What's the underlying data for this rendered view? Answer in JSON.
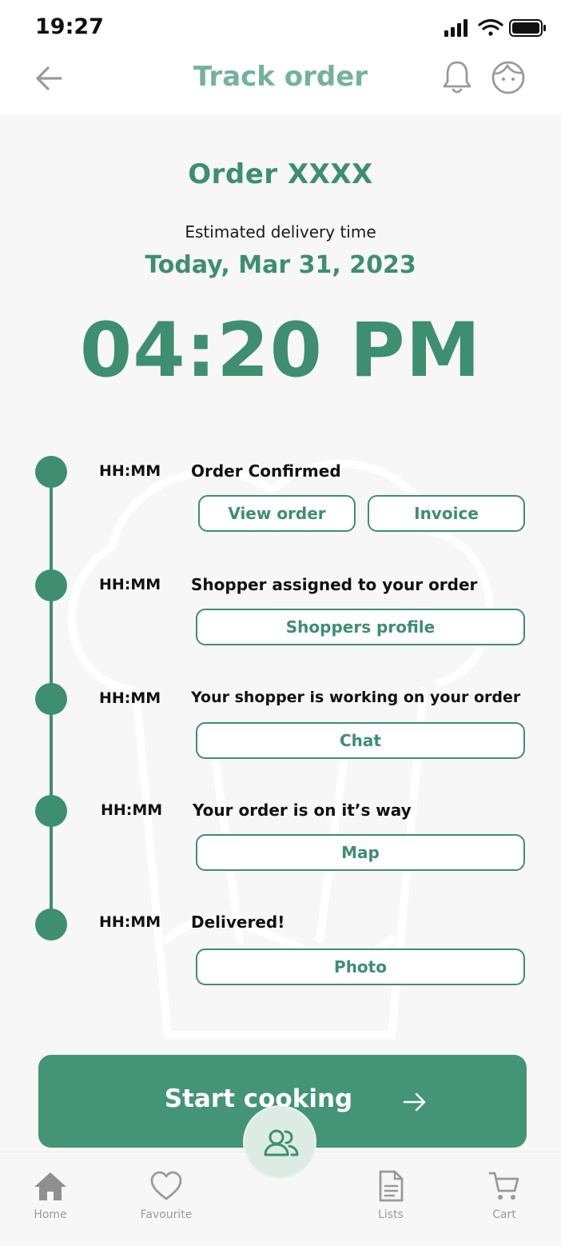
{
  "status_bar": {
    "time": "19:27"
  },
  "header": {
    "title": "Track order"
  },
  "order": {
    "title": "Order XXXX",
    "eta_label": "Estimated delivery time",
    "eta_date": "Today, Mar 31, 2023",
    "eta_time": "04:20 PM"
  },
  "timeline": [
    {
      "time": "HH:MM",
      "label": "Order Confirmed",
      "buttons": [
        "View order",
        "Invoice"
      ]
    },
    {
      "time": "HH:MM",
      "label": "Shopper assigned to your order",
      "buttons": [
        "Shoppers profile"
      ]
    },
    {
      "time": "HH:MM",
      "label": "Your shopper is working on your order",
      "buttons": [
        "Chat"
      ]
    },
    {
      "time": "HH:MM",
      "label": "Your order is on it’s way",
      "buttons": [
        "Map"
      ]
    },
    {
      "time": "HH:MM",
      "label": "Delivered!",
      "buttons": [
        "Photo"
      ]
    }
  ],
  "cta": {
    "label": "Start cooking"
  },
  "bottom_nav": {
    "items": [
      {
        "label": "Home",
        "icon": "home-icon"
      },
      {
        "label": "Favourite",
        "icon": "heart-icon"
      },
      {
        "label": "Lists",
        "icon": "document-icon"
      },
      {
        "label": "Cart",
        "icon": "cart-icon"
      }
    ],
    "fab_icon": "users-icon"
  },
  "colors": {
    "primary": "#3e8e72",
    "primary_light": "#73b39a",
    "cta": "#449477",
    "background": "#f6f7f6"
  }
}
